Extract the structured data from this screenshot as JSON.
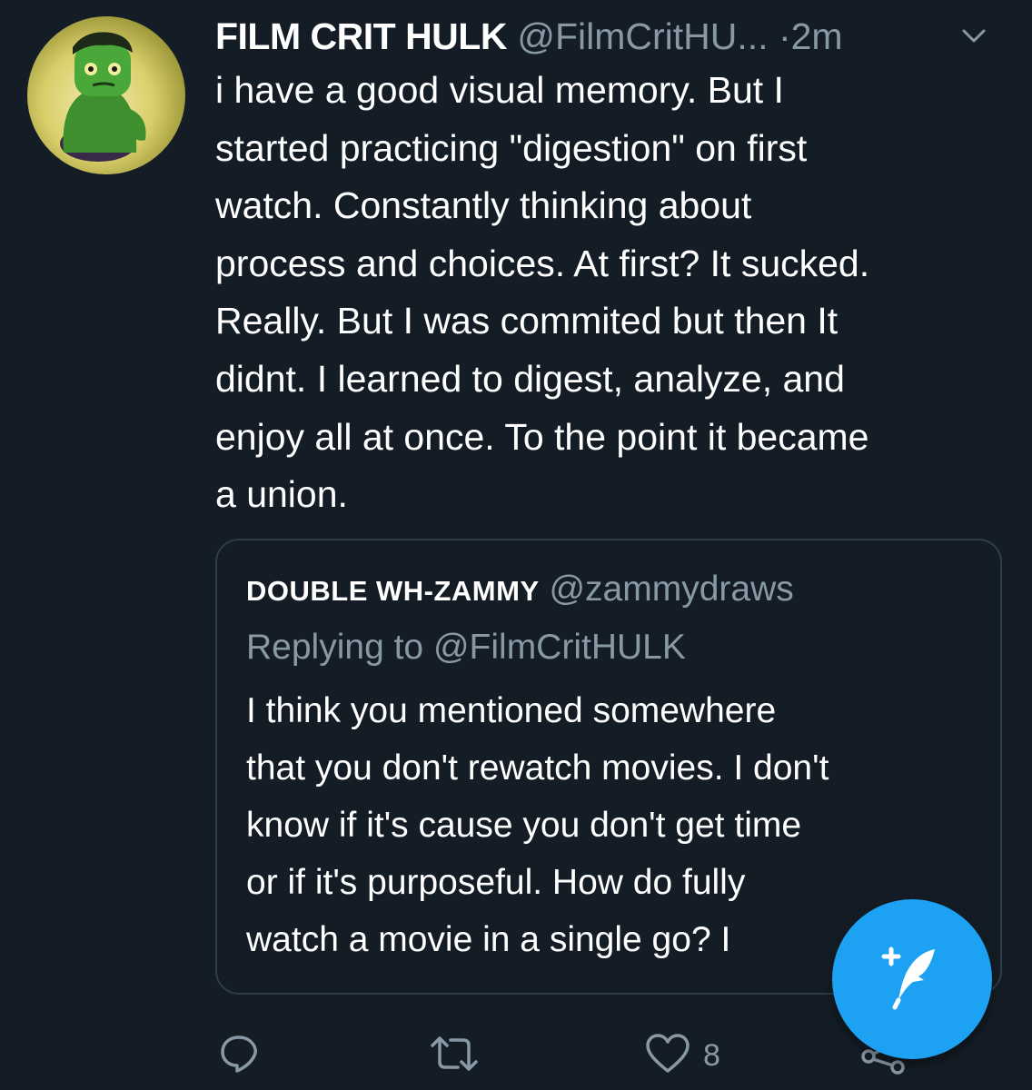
{
  "tweet": {
    "display_name": "FILM CRIT HULK",
    "handle": "@FilmCritHU...",
    "separator": "·",
    "time": "2m",
    "text_lines": [
      "i have a good visual memory. But I",
      "started practicing \"digestion\" on first",
      "watch. Constantly thinking about",
      "process and choices. At first? It sucked.",
      "Really. But I was commited but then It",
      "didnt. I learned to digest, analyze, and",
      "enjoy all at once. To the point it became",
      "a union."
    ]
  },
  "quoted_tweet": {
    "display_name": "DOUBLE WH-ZAMMY",
    "handle": "@zammydraws",
    "replying_to": "Replying to @FilmCritHULK",
    "text_lines": [
      "I think you mentioned somewhere",
      "that you don't rewatch movies. I don't",
      "know if it's cause you don't get time",
      "or if it's purposeful. How do fully",
      "watch a movie in a single go? I"
    ]
  },
  "actions": {
    "like_count": "8"
  },
  "icons": {
    "menu": "chevron-down-icon",
    "reply": "reply-icon",
    "retweet": "retweet-icon",
    "like": "heart-icon",
    "share": "share-icon",
    "compose": "compose-tweet-icon"
  },
  "colors": {
    "background": "#141d26",
    "text": "#ffffff",
    "muted": "#8899a6",
    "accent": "#1da1f2"
  }
}
